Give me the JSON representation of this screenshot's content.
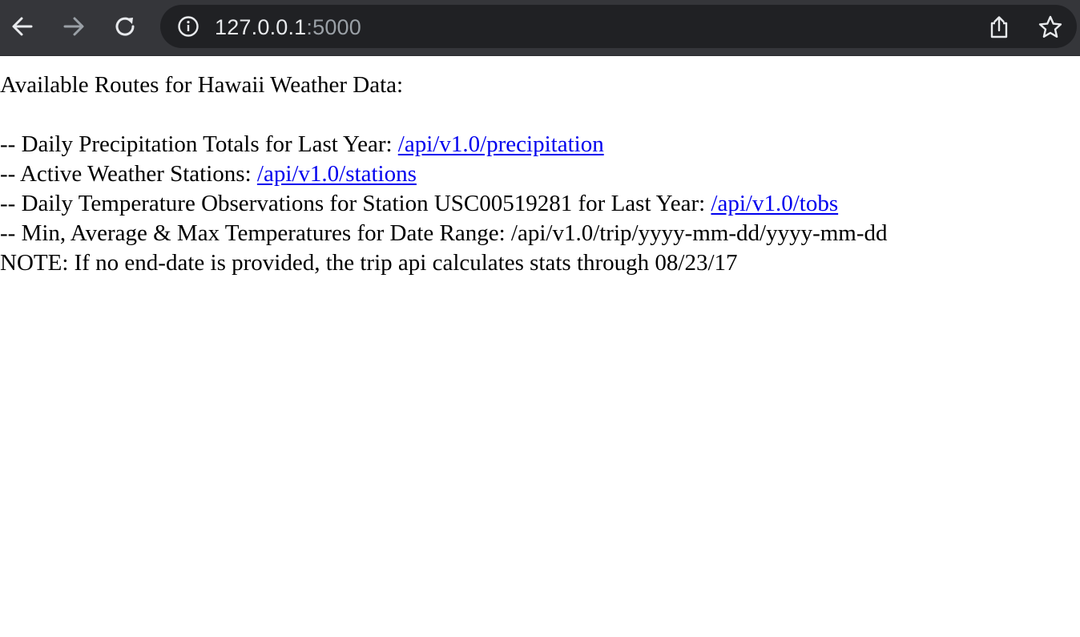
{
  "browser": {
    "url_host": "127.0.0.1",
    "url_port": ":5000",
    "icons": {
      "back": "back-arrow-icon",
      "forward": "forward-arrow-icon",
      "reload": "reload-icon",
      "info": "info-icon",
      "share": "share-icon",
      "bookmark": "star-icon"
    }
  },
  "page": {
    "heading": "Available Routes for Hawaii Weather Data:",
    "routes": [
      {
        "prefix": "-- Daily Precipitation Totals for Last Year: ",
        "link": "/api/v1.0/precipitation"
      },
      {
        "prefix": "-- Active Weather Stations: ",
        "link": "/api/v1.0/stations"
      },
      {
        "prefix": "-- Daily Temperature Observations for Station USC00519281 for Last Year: ",
        "link": "/api/v1.0/tobs"
      }
    ],
    "trip_route": "-- Min, Average & Max Temperatures for Date Range: /api/v1.0/trip/yyyy-mm-dd/yyyy-mm-dd",
    "note": "NOTE: If no end-date is provided, the trip api calculates stats through 08/23/17"
  }
}
